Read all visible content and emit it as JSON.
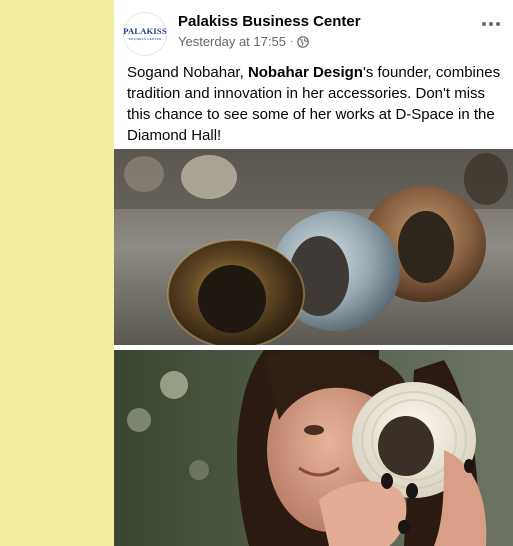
{
  "post": {
    "page_name": "Palakiss Business Center",
    "timestamp": "Yesterday at 17:55",
    "separator": "·",
    "avatar": {
      "brand": "PALAKISS",
      "tagline": "BUSINESS CENTER"
    },
    "text": {
      "part1": "Sogand Nobahar, ",
      "bold": "Nobahar Design",
      "part2": "'s founder, combines tradition and innovation in her accessories. Don't miss this chance to see some of her works at D-Space in the Diamond Hall!"
    },
    "photos": [
      {
        "name": "bracelets-photo",
        "subject": "handmade bracelets on a table"
      },
      {
        "name": "designer-photo",
        "subject": "woman holding a white ridged bracelet"
      }
    ]
  },
  "colors": {
    "background": "#f3ee9f",
    "card": "#ffffff",
    "name": "#050505",
    "meta": "#65676b",
    "brand": "#1f3c8c"
  },
  "icons": [
    "globe-icon",
    "more-icon"
  ]
}
